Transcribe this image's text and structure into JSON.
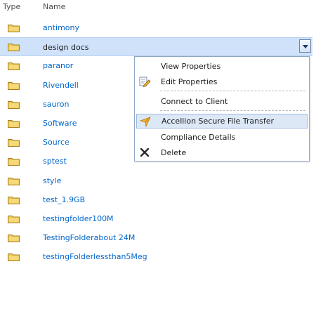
{
  "header": {
    "type_label": "Type",
    "name_label": "Name"
  },
  "items": [
    {
      "name": "antimony"
    },
    {
      "name": "design docs",
      "selected": true
    },
    {
      "name": "paranor"
    },
    {
      "name": "Rivendell"
    },
    {
      "name": "sauron"
    },
    {
      "name": "Software"
    },
    {
      "name": "Source"
    },
    {
      "name": "sptest"
    },
    {
      "name": "style"
    },
    {
      "name": "test_1.9GB"
    },
    {
      "name": "testingfolder100M"
    },
    {
      "name": "TestingFolderabout 24M"
    },
    {
      "name": "testingFolderlessthan5Meg"
    }
  ],
  "context_menu": {
    "view_properties": "View Properties",
    "edit_properties": "Edit Properties",
    "connect_to_client": "Connect to Client",
    "accellion": "Accellion Secure File Transfer",
    "compliance_details": "Compliance Details",
    "delete": "Delete"
  },
  "colors": {
    "link": "#0066cc",
    "selected_row": "#cfe2fa",
    "menu_highlight": "#dde8f7",
    "folder": "#e8c45a"
  },
  "icons": {
    "folder": "folder-icon",
    "dropdown": "chevron-down-icon",
    "edit": "edit-document-icon",
    "accellion": "accellion-arrow-icon",
    "delete": "delete-x-icon"
  }
}
